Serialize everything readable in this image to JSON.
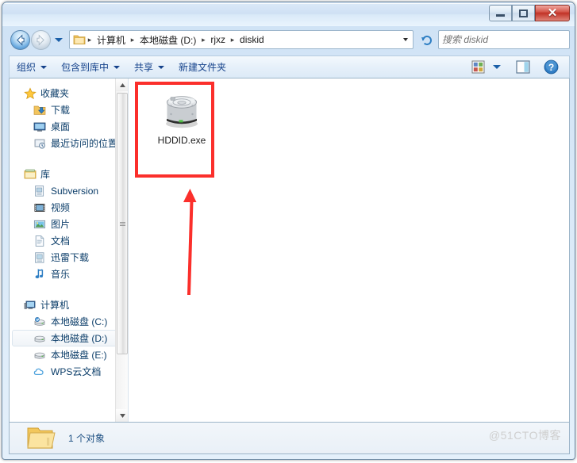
{
  "window": {
    "controls": {
      "minimize": "—",
      "maximize": "□",
      "close": "✕"
    }
  },
  "address": {
    "back_tooltip": "后退",
    "forward_tooltip": "前进",
    "crumbs": [
      "计算机",
      "本地磁盘 (D:)",
      "rjxz",
      "diskid"
    ],
    "separator": "▸"
  },
  "search": {
    "placeholder": "搜索 diskid",
    "value": ""
  },
  "toolbar": {
    "items": [
      {
        "label": "组织",
        "has_arrow": true
      },
      {
        "label": "包含到库中",
        "has_arrow": true
      },
      {
        "label": "共享",
        "has_arrow": true
      },
      {
        "label": "新建文件夹",
        "has_arrow": false
      }
    ],
    "view_icon": "view-options-icon",
    "view_arrow": "chevron-down-icon",
    "preview_icon": "preview-pane-icon",
    "help_icon": "help-icon"
  },
  "sidebar": {
    "groups": [
      {
        "header": {
          "label": "收藏夹",
          "icon": "star-icon"
        },
        "items": [
          {
            "label": "下载",
            "icon": "downloads-icon",
            "selected": false
          },
          {
            "label": "桌面",
            "icon": "desktop-icon",
            "selected": false
          },
          {
            "label": "最近访问的位置",
            "icon": "recent-places-icon",
            "selected": false
          }
        ]
      },
      {
        "header": {
          "label": "库",
          "icon": "library-icon"
        },
        "items": [
          {
            "label": "Subversion",
            "icon": "subversion-icon",
            "selected": false
          },
          {
            "label": "视频",
            "icon": "videos-icon",
            "selected": false
          },
          {
            "label": "图片",
            "icon": "pictures-icon",
            "selected": false
          },
          {
            "label": "文档",
            "icon": "documents-icon",
            "selected": false
          },
          {
            "label": "迅雷下载",
            "icon": "thunder-download-icon",
            "selected": false
          },
          {
            "label": "音乐",
            "icon": "music-icon",
            "selected": false
          }
        ]
      },
      {
        "header": {
          "label": "计算机",
          "icon": "computer-icon"
        },
        "items": [
          {
            "label": "本地磁盘 (C:)",
            "icon": "system-drive-icon",
            "selected": false
          },
          {
            "label": "本地磁盘 (D:)",
            "icon": "drive-icon",
            "selected": true
          },
          {
            "label": "本地磁盘 (E:)",
            "icon": "drive-icon",
            "selected": false
          },
          {
            "label": "WPS云文档",
            "icon": "cloud-icon",
            "selected": false
          }
        ]
      }
    ]
  },
  "content": {
    "files": [
      {
        "name": "HDDID.exe",
        "icon": "hard-disk-icon",
        "highlighted": true
      }
    ]
  },
  "annotation": {
    "box_color": "#fb2f2b",
    "arrow_color": "#fb2f2b"
  },
  "statusbar": {
    "folder_icon": "folder-icon",
    "text": "1 个对象"
  },
  "watermark": {
    "text": "@51CTO博客"
  }
}
